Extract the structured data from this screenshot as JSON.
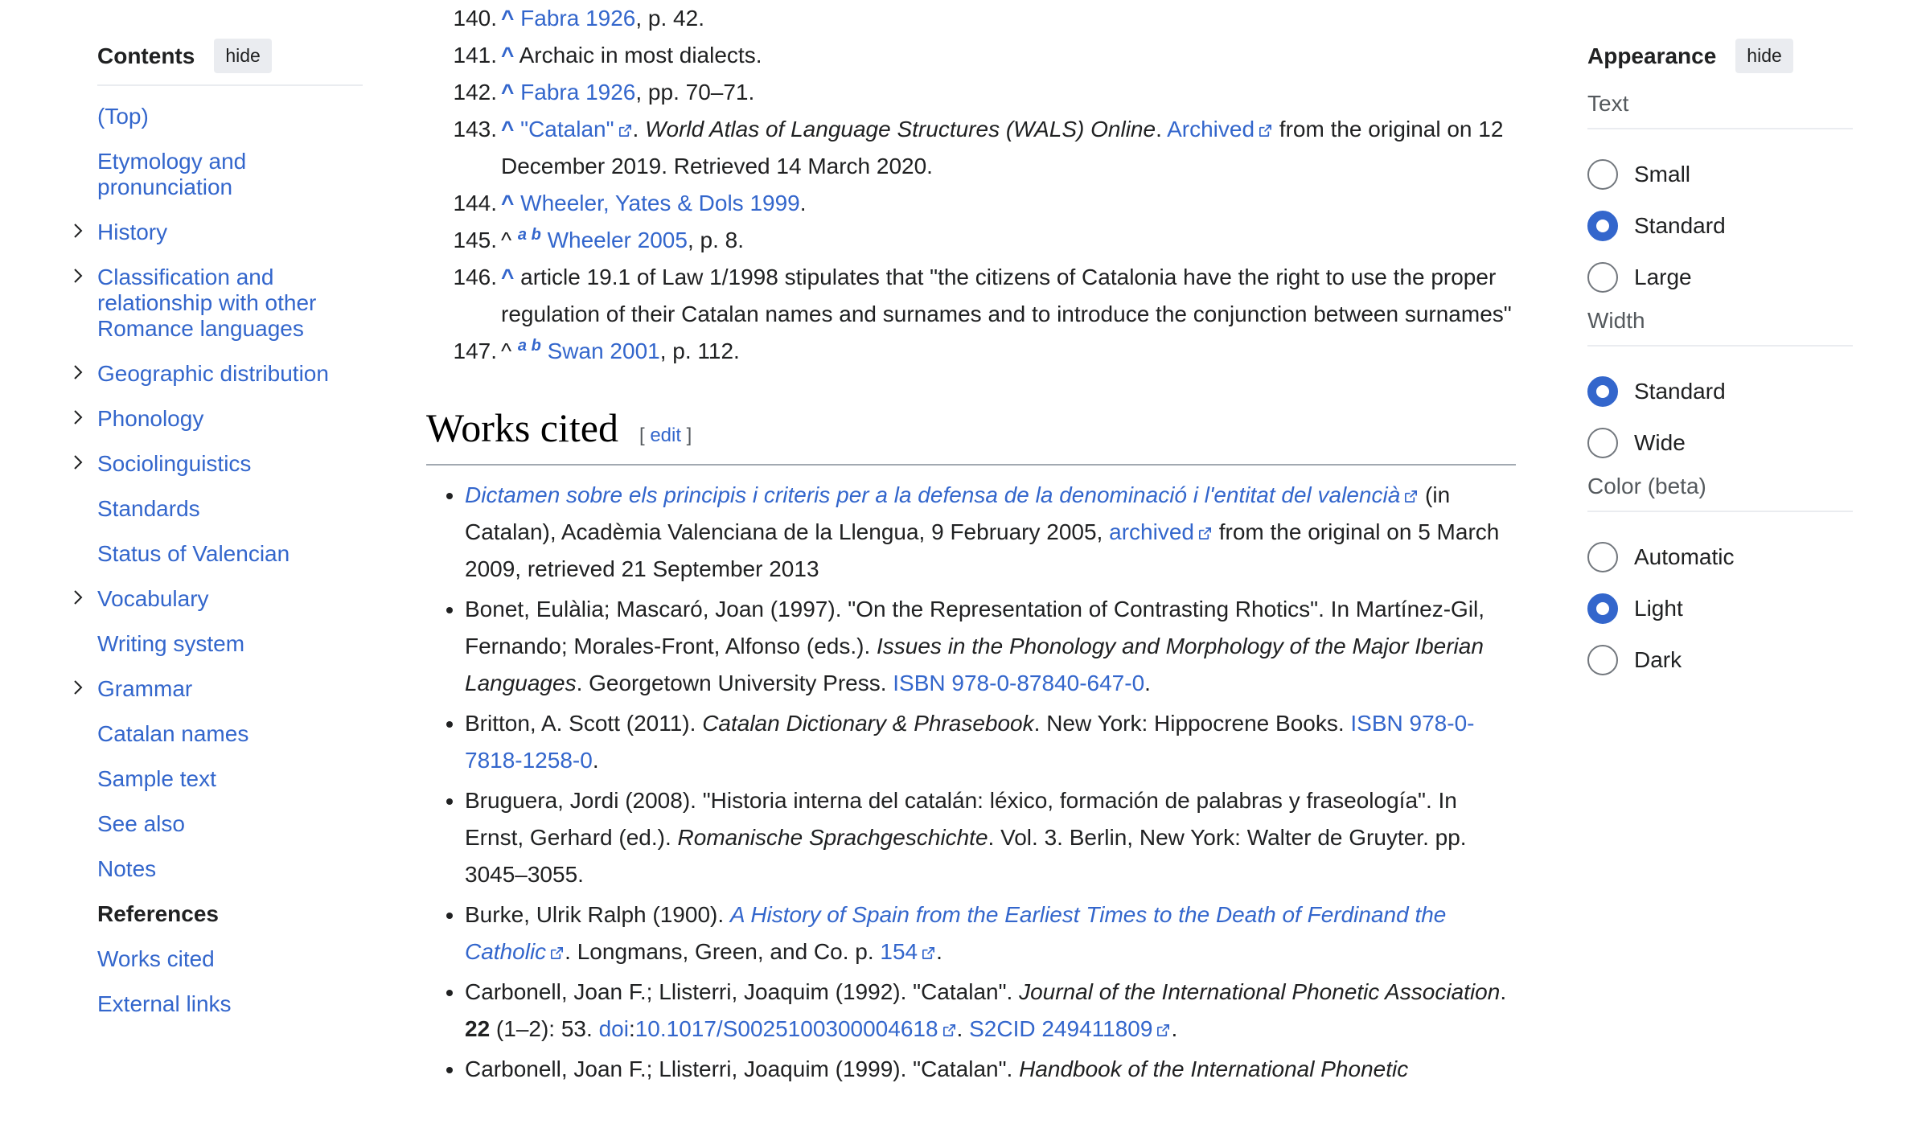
{
  "toc": {
    "title": "Contents",
    "hide_label": "hide",
    "items": [
      {
        "label": "(Top)",
        "expandable": false
      },
      {
        "label": "Etymology and pronunciation",
        "expandable": false
      },
      {
        "label": "History",
        "expandable": true
      },
      {
        "label": "Classification and relationship with other Romance languages",
        "expandable": true
      },
      {
        "label": "Geographic distribution",
        "expandable": true
      },
      {
        "label": "Phonology",
        "expandable": true
      },
      {
        "label": "Sociolinguistics",
        "expandable": true
      },
      {
        "label": "Standards",
        "expandable": false
      },
      {
        "label": "Status of Valencian",
        "expandable": false
      },
      {
        "label": "Vocabulary",
        "expandable": true
      },
      {
        "label": "Writing system",
        "expandable": false
      },
      {
        "label": "Grammar",
        "expandable": true
      },
      {
        "label": "Catalan names",
        "expandable": false
      },
      {
        "label": "Sample text",
        "expandable": false
      },
      {
        "label": "See also",
        "expandable": false
      },
      {
        "label": "Notes",
        "expandable": false
      },
      {
        "label": "References",
        "expandable": false,
        "active": true
      },
      {
        "label": "Works cited",
        "expandable": false
      },
      {
        "label": "External links",
        "expandable": false
      }
    ]
  },
  "notes": {
    "n140": {
      "num": "140.",
      "caret": "^",
      "link": "Fabra 1926",
      "rest": ", p. 42."
    },
    "n141": {
      "num": "141.",
      "caret": "^",
      "text": " Archaic in most dialects."
    },
    "n142": {
      "num": "142.",
      "caret": "^",
      "link": "Fabra 1926",
      "rest": ", pp. 70–71."
    },
    "n143": {
      "num": "143.",
      "caret": "^",
      "link": "\"Catalan\"",
      "sep": ". ",
      "title": "World Atlas of Language Structures (WALS) Online",
      "dot": ". ",
      "archived": "Archived",
      "rest": " from the original on 12 December 2019. Retrieved 14 March 2020."
    },
    "n144": {
      "num": "144.",
      "caret": "^",
      "link": "Wheeler, Yates & Dols 1999",
      "rest": "."
    },
    "n145": {
      "num": "145.",
      "caret": "^",
      "a": "a",
      "b": "b",
      "link": "Wheeler 2005",
      "rest": ", p. 8."
    },
    "n146": {
      "num": "146.",
      "caret": "^",
      "text": " article 19.1 of Law 1/1998 stipulates that \"the citizens of Catalonia have the right to use the proper regulation of their Catalan names and surnames and to introduce the conjunction between surnames\""
    },
    "n147": {
      "num": "147.",
      "caret": "^",
      "a": "a",
      "b": "b",
      "link": "Swan 2001",
      "rest": ", p. 112."
    }
  },
  "works_cited": {
    "heading": "Works cited",
    "edit_open": "[ ",
    "edit_label": "edit",
    "edit_close": " ]",
    "w1": {
      "title": "Dictamen sobre els principis i criteris per a la defensa de la denominació i l'entitat del valencià",
      "t1": " (in Catalan), Acadèmia Valenciana de la Llengua, 9 February 2005, ",
      "archived": "archived",
      "t2": " from the original on 5 March 2009, retrieved 21 September 2013"
    },
    "w2": {
      "t1": "Bonet, Eulàlia; Mascaró, Joan (1997). \"On the Representation of Contrasting Rhotics\". In Martínez-Gil, Fernando; Morales-Front, Alfonso (eds.). ",
      "title": "Issues in the Phonology and Morphology of the Major Iberian Languages",
      "t2": ". Georgetown University Press. ",
      "isbn": "ISBN 978-0-87840-647-0",
      "t3": "."
    },
    "w3": {
      "t1": "Britton, A. Scott (2011). ",
      "title": "Catalan Dictionary & Phrasebook",
      "t2": ". New York: Hippocrene Books. ",
      "isbn": "ISBN 978-0-7818-1258-0",
      "t3": "."
    },
    "w4": {
      "t1": "Bruguera, Jordi (2008). \"Historia interna del catalán: léxico, formación de palabras y fraseología\". In Ernst, Gerhard (ed.). ",
      "title": "Romanische Sprachgeschichte",
      "t2": ". Vol. 3. Berlin, New York: Walter de Gruyter. pp. 3045–3055."
    },
    "w5": {
      "t1": "Burke, Ulrik Ralph (1900). ",
      "title": "A History of Spain from the Earliest Times to the Death of Ferdinand the Catholic",
      "t2": ". Longmans, Green, and Co. p. ",
      "page": "154",
      "t3": "."
    },
    "w6": {
      "t1": "Carbonell, Joan F.; Llisterri, Joaquim (1992). \"Catalan\". ",
      "title": "Journal of the International Phonetic Association",
      "t2": ". ",
      "vol": "22",
      "t3": " (1–2): 53. ",
      "doi": "doi",
      "colon": ":",
      "doi_val": "10.1017/S0025100300004618",
      "t4": ". ",
      "s2cid": "S2CID 249411809",
      "t5": "."
    },
    "w7": {
      "t1": "Carbonell, Joan F.; Llisterri, Joaquim (1999). \"Catalan\". ",
      "title": "Handbook of the International Phonetic"
    }
  },
  "appearance": {
    "title": "Appearance",
    "hide_label": "hide",
    "text_group": {
      "title": "Text",
      "options": [
        "Small",
        "Standard",
        "Large"
      ],
      "selected": "Standard"
    },
    "width_group": {
      "title": "Width",
      "options": [
        "Standard",
        "Wide"
      ],
      "selected": "Standard"
    },
    "color_group": {
      "title": "Color (beta)",
      "options": [
        "Automatic",
        "Light",
        "Dark"
      ],
      "selected": "Light"
    }
  },
  "colors": {
    "link": "#3366cc",
    "text": "#202122",
    "radio_checked": "#3366cc"
  }
}
